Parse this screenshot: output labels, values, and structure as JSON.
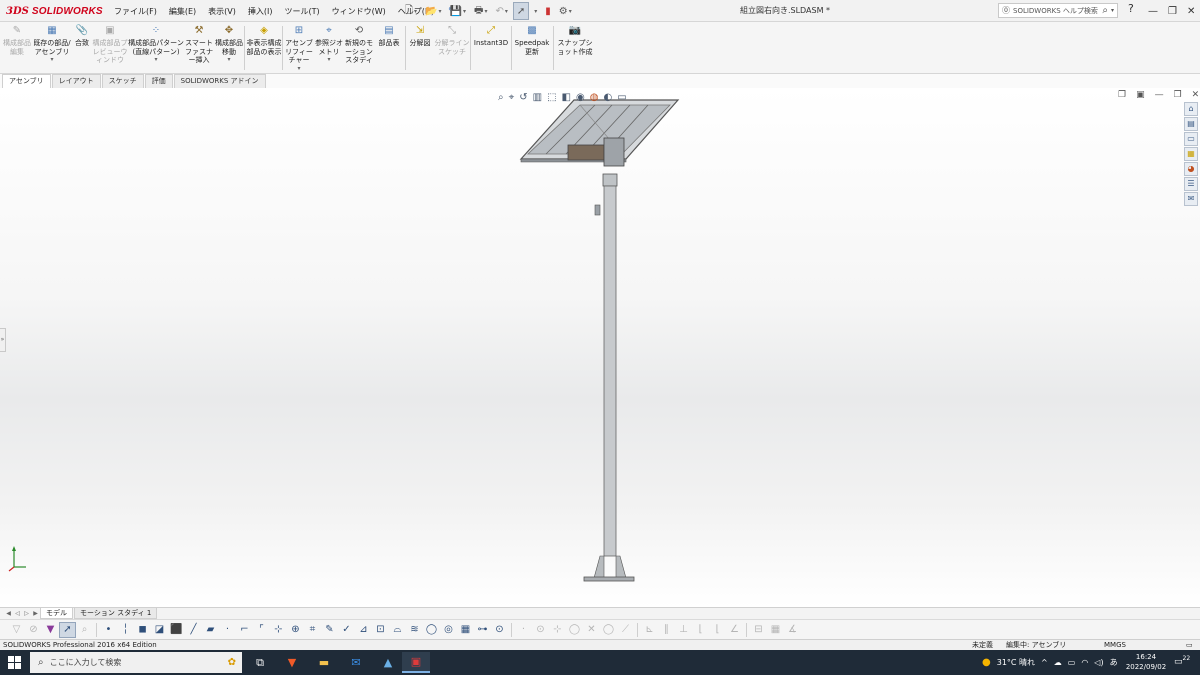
{
  "app": {
    "logo_ds": "3DS",
    "logo_text": "SOLIDWORKS",
    "menus": [
      "ファイル(F)",
      "編集(E)",
      "表示(V)",
      "挿入(I)",
      "ツール(T)",
      "ウィンドウ(W)",
      "ヘルプ(H)"
    ],
    "document_title": "組立図右向き.SLDASM *",
    "help_search_placeholder": "SOLIDWORKS ヘルプ検索",
    "help_q": "?"
  },
  "command_manager": {
    "items": [
      {
        "label": "構成部品編集",
        "disabled": true
      },
      {
        "label": "既存の部品/アセンブリ",
        "disabled": false
      },
      {
        "label": "合致",
        "disabled": false
      },
      {
        "label": "構成部品プレビューウィンドウ",
        "disabled": true
      },
      {
        "label": "構成部品パターン(直線パターン)",
        "disabled": false
      },
      {
        "label": "スマートファスナー挿入",
        "disabled": false
      },
      {
        "label": "構成部品移動",
        "disabled": false
      },
      {
        "label": "非表示構成部品の表示",
        "disabled": false
      },
      {
        "label": "アセンブリフィーチャー",
        "disabled": false
      },
      {
        "label": "参照ジオメトリ",
        "disabled": false
      },
      {
        "label": "新規のモーションスタディ",
        "disabled": false
      },
      {
        "label": "部品表",
        "disabled": false
      },
      {
        "label": "分解図",
        "disabled": false
      },
      {
        "label": "分解ラインスケッチ",
        "disabled": true
      },
      {
        "label": "Instant3D",
        "disabled": false
      },
      {
        "label": "Speedpak更新",
        "disabled": false
      },
      {
        "label": "スナップショット作成",
        "disabled": false
      }
    ]
  },
  "tabs": [
    "アセンブリ",
    "レイアウト",
    "スケッチ",
    "評価",
    "SOLIDWORKS アドイン"
  ],
  "active_tab": "アセンブリ",
  "bottom_tabs": [
    "モデル",
    "モーション スタディ 1"
  ],
  "active_bottom_tab": "モデル",
  "status": {
    "edition": "SOLIDWORKS Professional 2016 x64 Edition",
    "defined_state": "未定義",
    "editing": "編集中: アセンブリ",
    "units": "MMGS"
  },
  "taskbar": {
    "search_placeholder": "ここに入力して検索",
    "weather": "31°C 晴れ",
    "ime": "あ",
    "time": "16:24",
    "date": "2022/09/02",
    "notifications": "22"
  },
  "colors": {
    "brand_red": "#d0021b",
    "taskbar_bg": "#1f2b38",
    "selection_blue": "#cfd8e3"
  }
}
